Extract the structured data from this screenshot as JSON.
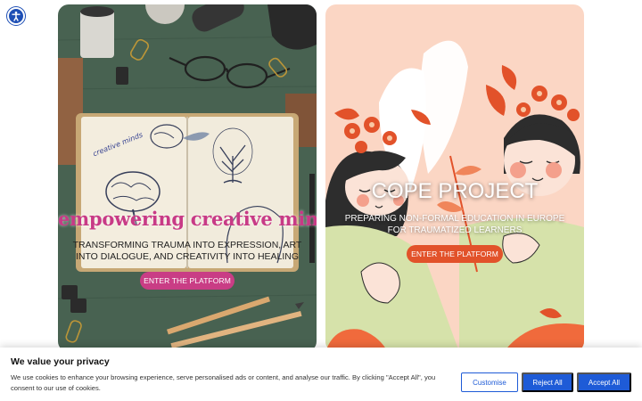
{
  "accessibility": {
    "icon": "accessibility-icon"
  },
  "cards": {
    "left": {
      "title": "empowering creative mind",
      "subtitle": "TRANSFORMING TRAUMA INTO EXPRESSION, ART INTO DIALOGUE, AND CREATIVITY INTO HEALING",
      "button": "ENTER THE PLATFORM",
      "notebook_note": "creative minds",
      "accent": "#c93d85"
    },
    "right": {
      "title": "COPE PROJECT",
      "subtitle": "PREPARING NON-FORMAL EDUCATION IN EUROPE FOR TRAUMATIZED LEARNERS",
      "button": "ENTER THE PLATFORM",
      "accent": "#e2522a"
    }
  },
  "cookie": {
    "title": "We value your privacy",
    "text": "We use cookies to enhance your browsing experience, serve personalised ads or content, and analyse our traffic. By clicking \"Accept All\", you consent to our use of cookies.",
    "customise": "Customise",
    "reject": "Reject All",
    "accept": "Accept All",
    "button_color": "#1e5bd7"
  }
}
